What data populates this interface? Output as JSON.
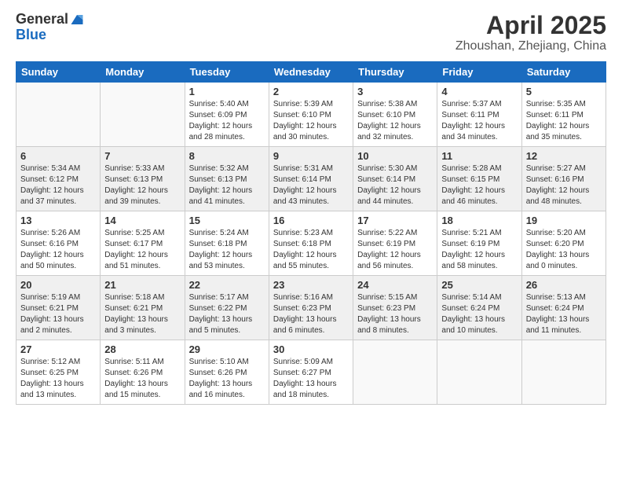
{
  "header": {
    "logo_general": "General",
    "logo_blue": "Blue",
    "month_title": "April 2025",
    "location": "Zhoushan, Zhejiang, China"
  },
  "days_of_week": [
    "Sunday",
    "Monday",
    "Tuesday",
    "Wednesday",
    "Thursday",
    "Friday",
    "Saturday"
  ],
  "weeks": [
    [
      {
        "day": "",
        "info": ""
      },
      {
        "day": "",
        "info": ""
      },
      {
        "day": "1",
        "info": "Sunrise: 5:40 AM\nSunset: 6:09 PM\nDaylight: 12 hours\nand 28 minutes."
      },
      {
        "day": "2",
        "info": "Sunrise: 5:39 AM\nSunset: 6:10 PM\nDaylight: 12 hours\nand 30 minutes."
      },
      {
        "day": "3",
        "info": "Sunrise: 5:38 AM\nSunset: 6:10 PM\nDaylight: 12 hours\nand 32 minutes."
      },
      {
        "day": "4",
        "info": "Sunrise: 5:37 AM\nSunset: 6:11 PM\nDaylight: 12 hours\nand 34 minutes."
      },
      {
        "day": "5",
        "info": "Sunrise: 5:35 AM\nSunset: 6:11 PM\nDaylight: 12 hours\nand 35 minutes."
      }
    ],
    [
      {
        "day": "6",
        "info": "Sunrise: 5:34 AM\nSunset: 6:12 PM\nDaylight: 12 hours\nand 37 minutes."
      },
      {
        "day": "7",
        "info": "Sunrise: 5:33 AM\nSunset: 6:13 PM\nDaylight: 12 hours\nand 39 minutes."
      },
      {
        "day": "8",
        "info": "Sunrise: 5:32 AM\nSunset: 6:13 PM\nDaylight: 12 hours\nand 41 minutes."
      },
      {
        "day": "9",
        "info": "Sunrise: 5:31 AM\nSunset: 6:14 PM\nDaylight: 12 hours\nand 43 minutes."
      },
      {
        "day": "10",
        "info": "Sunrise: 5:30 AM\nSunset: 6:14 PM\nDaylight: 12 hours\nand 44 minutes."
      },
      {
        "day": "11",
        "info": "Sunrise: 5:28 AM\nSunset: 6:15 PM\nDaylight: 12 hours\nand 46 minutes."
      },
      {
        "day": "12",
        "info": "Sunrise: 5:27 AM\nSunset: 6:16 PM\nDaylight: 12 hours\nand 48 minutes."
      }
    ],
    [
      {
        "day": "13",
        "info": "Sunrise: 5:26 AM\nSunset: 6:16 PM\nDaylight: 12 hours\nand 50 minutes."
      },
      {
        "day": "14",
        "info": "Sunrise: 5:25 AM\nSunset: 6:17 PM\nDaylight: 12 hours\nand 51 minutes."
      },
      {
        "day": "15",
        "info": "Sunrise: 5:24 AM\nSunset: 6:18 PM\nDaylight: 12 hours\nand 53 minutes."
      },
      {
        "day": "16",
        "info": "Sunrise: 5:23 AM\nSunset: 6:18 PM\nDaylight: 12 hours\nand 55 minutes."
      },
      {
        "day": "17",
        "info": "Sunrise: 5:22 AM\nSunset: 6:19 PM\nDaylight: 12 hours\nand 56 minutes."
      },
      {
        "day": "18",
        "info": "Sunrise: 5:21 AM\nSunset: 6:19 PM\nDaylight: 12 hours\nand 58 minutes."
      },
      {
        "day": "19",
        "info": "Sunrise: 5:20 AM\nSunset: 6:20 PM\nDaylight: 13 hours\nand 0 minutes."
      }
    ],
    [
      {
        "day": "20",
        "info": "Sunrise: 5:19 AM\nSunset: 6:21 PM\nDaylight: 13 hours\nand 2 minutes."
      },
      {
        "day": "21",
        "info": "Sunrise: 5:18 AM\nSunset: 6:21 PM\nDaylight: 13 hours\nand 3 minutes."
      },
      {
        "day": "22",
        "info": "Sunrise: 5:17 AM\nSunset: 6:22 PM\nDaylight: 13 hours\nand 5 minutes."
      },
      {
        "day": "23",
        "info": "Sunrise: 5:16 AM\nSunset: 6:23 PM\nDaylight: 13 hours\nand 6 minutes."
      },
      {
        "day": "24",
        "info": "Sunrise: 5:15 AM\nSunset: 6:23 PM\nDaylight: 13 hours\nand 8 minutes."
      },
      {
        "day": "25",
        "info": "Sunrise: 5:14 AM\nSunset: 6:24 PM\nDaylight: 13 hours\nand 10 minutes."
      },
      {
        "day": "26",
        "info": "Sunrise: 5:13 AM\nSunset: 6:24 PM\nDaylight: 13 hours\nand 11 minutes."
      }
    ],
    [
      {
        "day": "27",
        "info": "Sunrise: 5:12 AM\nSunset: 6:25 PM\nDaylight: 13 hours\nand 13 minutes."
      },
      {
        "day": "28",
        "info": "Sunrise: 5:11 AM\nSunset: 6:26 PM\nDaylight: 13 hours\nand 15 minutes."
      },
      {
        "day": "29",
        "info": "Sunrise: 5:10 AM\nSunset: 6:26 PM\nDaylight: 13 hours\nand 16 minutes."
      },
      {
        "day": "30",
        "info": "Sunrise: 5:09 AM\nSunset: 6:27 PM\nDaylight: 13 hours\nand 18 minutes."
      },
      {
        "day": "",
        "info": ""
      },
      {
        "day": "",
        "info": ""
      },
      {
        "day": "",
        "info": ""
      }
    ]
  ]
}
